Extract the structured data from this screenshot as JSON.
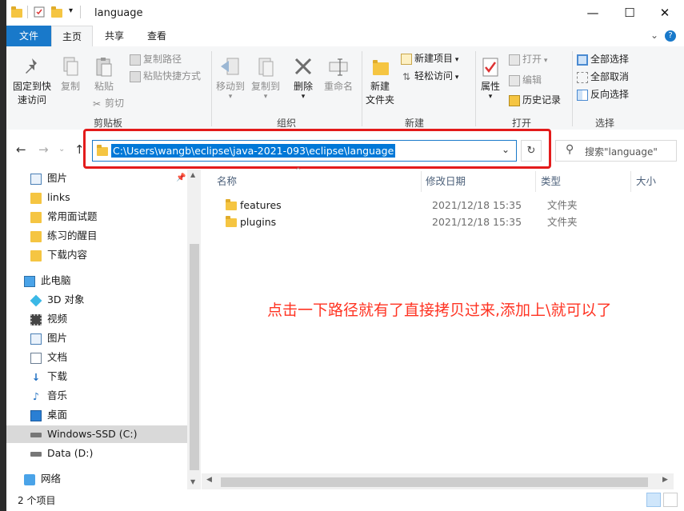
{
  "window": {
    "title": "language",
    "controls": {
      "minimize": "—",
      "maximize": "☐",
      "close": "✕"
    }
  },
  "ribbon_tabs": [
    {
      "label": "文件"
    },
    {
      "label": "主页"
    },
    {
      "label": "共享"
    },
    {
      "label": "查看"
    }
  ],
  "ribbon": {
    "clipboard": {
      "group_label": "剪贴板",
      "pin": "固定到快速访问",
      "pin_line1": "固定到快",
      "pin_line2": "速访问",
      "copy": "复制",
      "paste": "粘贴",
      "copy_path": "复制路径",
      "paste_shortcut": "粘贴快捷方式",
      "cut": "剪切"
    },
    "organize": {
      "group_label": "组织",
      "move_to": "移动到",
      "copy_to": "复制到",
      "delete": "删除",
      "rename": "重命名"
    },
    "new": {
      "group_label": "新建",
      "new_folder_line1": "新建",
      "new_folder_line2": "文件夹",
      "new_item": "新建项目",
      "easy_access": "轻松访问"
    },
    "open": {
      "group_label": "打开",
      "properties": "属性",
      "open": "打开",
      "edit": "编辑",
      "history": "历史记录"
    },
    "select": {
      "group_label": "选择",
      "select_all": "全部选择",
      "select_none": "全部取消",
      "invert": "反向选择"
    }
  },
  "address": {
    "path": "C:\\Users\\wangb\\eclipse\\java-2021-093\\eclipse\\language",
    "search_placeholder": "搜索\"language\""
  },
  "nav_pane": {
    "quick_access": [
      {
        "label": "图片"
      },
      {
        "label": "links"
      },
      {
        "label": "常用面试题"
      },
      {
        "label": "练习的醒目"
      },
      {
        "label": "下载内容"
      }
    ],
    "this_pc": "此电脑",
    "pc_items": [
      {
        "label": "3D 对象",
        "icon": "3d-objects-icon"
      },
      {
        "label": "视频",
        "icon": "video-icon"
      },
      {
        "label": "图片",
        "icon": "pictures-icon"
      },
      {
        "label": "文档",
        "icon": "documents-icon"
      },
      {
        "label": "下载",
        "icon": "download-icon"
      },
      {
        "label": "音乐",
        "icon": "music-icon"
      },
      {
        "label": "桌面",
        "icon": "desktop-icon"
      },
      {
        "label": "Windows-SSD (C:)",
        "icon": "drive-icon"
      },
      {
        "label": "Data (D:)",
        "icon": "drive-icon"
      }
    ],
    "network": "网络"
  },
  "file_list": {
    "columns": [
      "名称",
      "修改日期",
      "类型",
      "大小"
    ],
    "rows": [
      {
        "name": "features",
        "modified": "2021/12/18 15:35",
        "type": "文件夹",
        "size": ""
      },
      {
        "name": "plugins",
        "modified": "2021/12/18 15:35",
        "type": "文件夹",
        "size": ""
      }
    ]
  },
  "annotation": "点击一下路径就有了直接拷贝过来,添加上\\就可以了",
  "status": {
    "item_count": "2 个项目"
  },
  "colors": {
    "accent": "#1979ca",
    "selection": "#0078d7",
    "annotation_red": "#e31b1b",
    "folder": "#f5c542"
  }
}
